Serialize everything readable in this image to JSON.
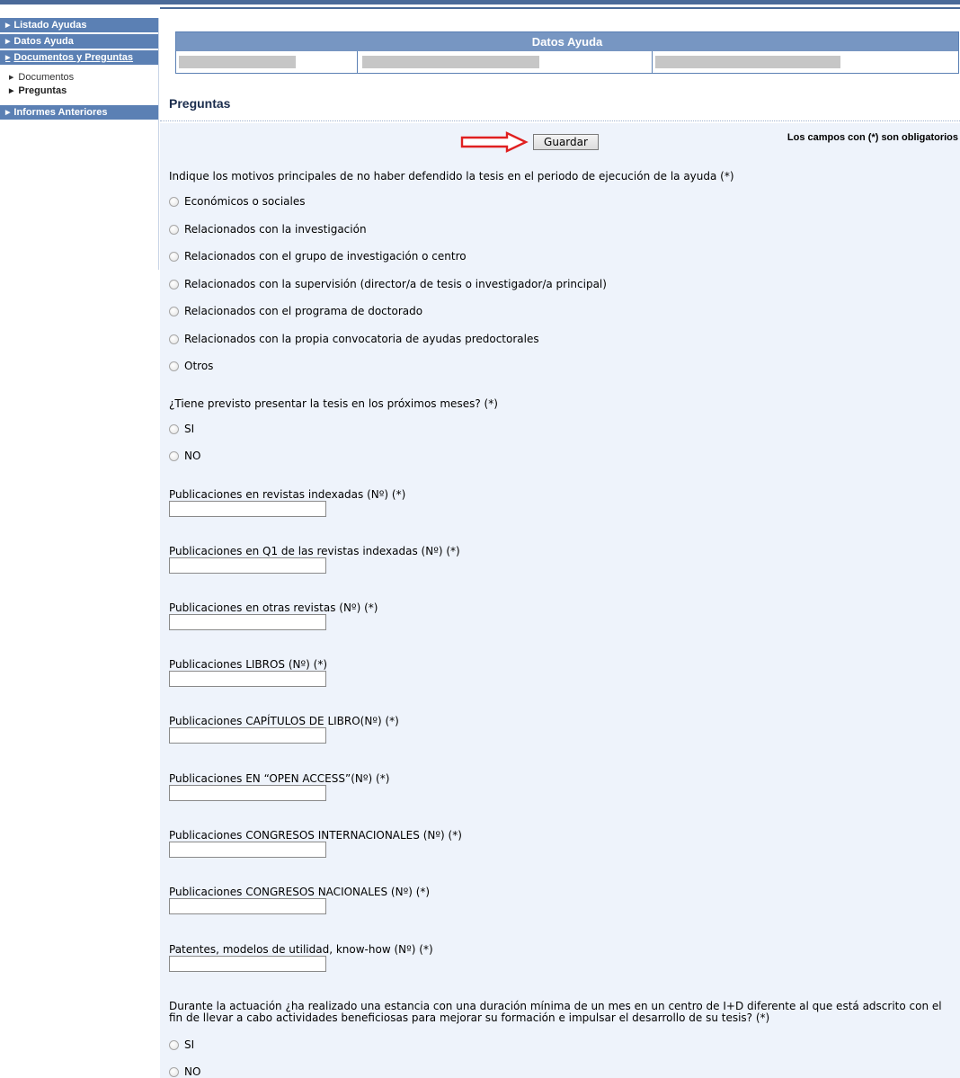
{
  "sidebar": {
    "items_top": [
      "Listado Ayudas",
      "Datos Ayuda",
      "Documentos y Preguntas"
    ],
    "subitems": [
      "Documentos",
      "Preguntas"
    ],
    "items_bottom": [
      "Informes Anteriores"
    ]
  },
  "datos_ayuda": {
    "title": "Datos Ayuda"
  },
  "page": {
    "title": "Preguntas",
    "save_label": "Guardar",
    "required_note": "Los campos con (*) son obligatorios"
  },
  "q1": {
    "text": "Indique los motivos principales de no haber defendido la tesis en el periodo de ejecución de la ayuda (*)",
    "options": [
      "Económicos o sociales",
      "Relacionados con la investigación",
      "Relacionados con el grupo de investigación o centro",
      "Relacionados con la supervisión (director/a de tesis o investigador/a principal)",
      "Relacionados con el programa de doctorado",
      "Relacionados con la propia convocatoria de ayudas predoctorales",
      "Otros"
    ]
  },
  "q2": {
    "text": "¿Tiene previsto presentar la tesis en los próximos meses? (*)",
    "options": [
      "SI",
      "NO"
    ]
  },
  "fields": [
    {
      "label": "Publicaciones en revistas indexadas (Nº) (*)",
      "value": ""
    },
    {
      "label": "Publicaciones en Q1 de las revistas indexadas (Nº) (*)",
      "value": ""
    },
    {
      "label": "Publicaciones en otras revistas (Nº) (*)",
      "value": ""
    },
    {
      "label": "Publicaciones LIBROS (Nº) (*)",
      "value": ""
    },
    {
      "label": "Publicaciones CAPÍTULOS DE LIBRO(Nº) (*)",
      "value": ""
    },
    {
      "label": "Publicaciones EN “OPEN ACCESS”(Nº) (*)",
      "value": ""
    },
    {
      "label": "Publicaciones CONGRESOS INTERNACIONALES (Nº) (*)",
      "value": ""
    },
    {
      "label": "Publicaciones CONGRESOS NACIONALES (Nº) (*)",
      "value": ""
    },
    {
      "label": "Patentes, modelos de utilidad, know-how (Nº) (*)",
      "value": ""
    }
  ],
  "q3": {
    "text": "Durante la actuación ¿ha realizado una estancia con una duración mínima de un mes en un centro de I+D diferente al que está adscrito con el fin de llevar a cabo actividades beneficiosas para mejorar su formación e impulsar el desarrollo de su tesis? (*)",
    "options": [
      "SI",
      "NO"
    ]
  },
  "colors": {
    "accent": "#5b80b4",
    "content_bg": "#eef3fb",
    "arrow": "#e02020"
  }
}
